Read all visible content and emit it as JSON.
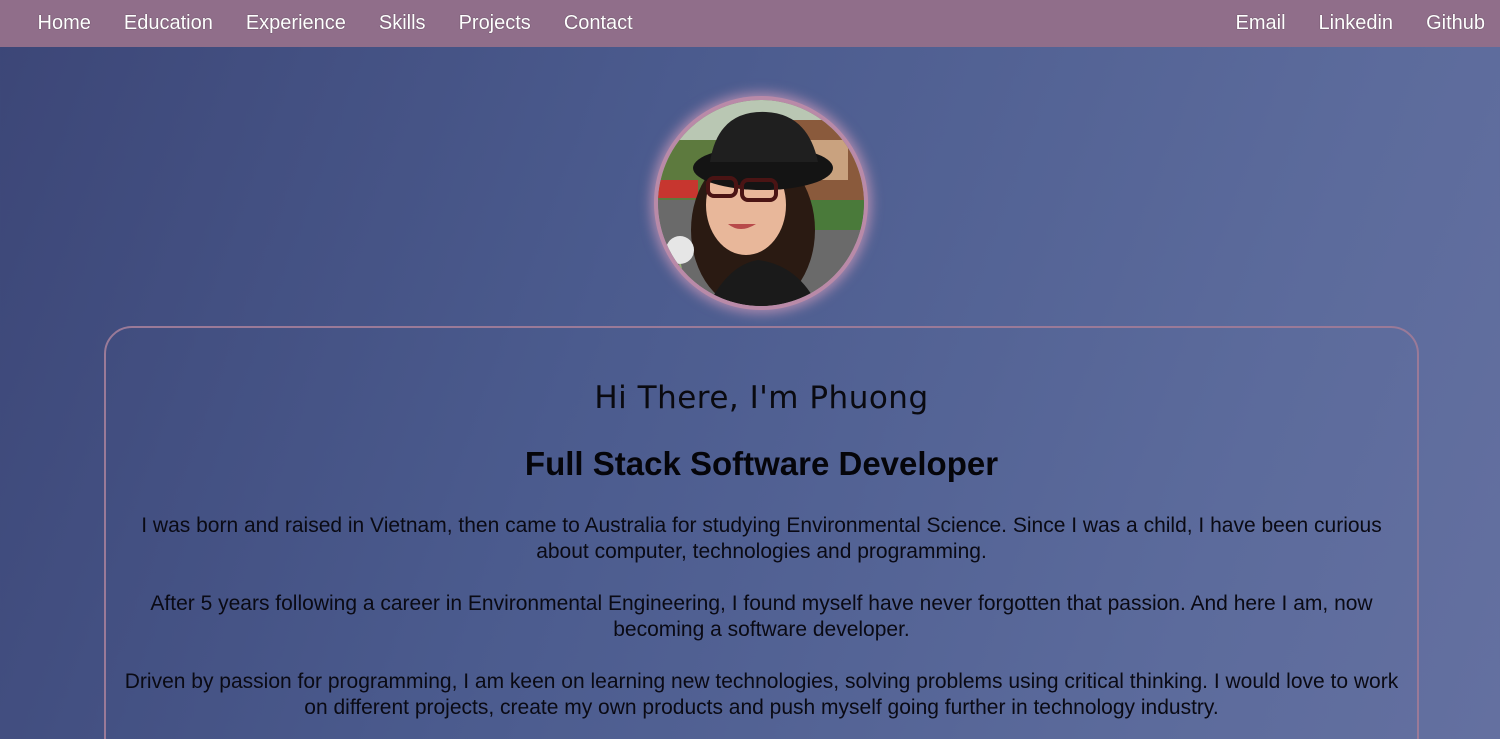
{
  "nav": {
    "left": [
      "Home",
      "Education",
      "Experience",
      "Skills",
      "Projects",
      "Contact"
    ],
    "right": [
      "Email",
      "Linkedin",
      "Github"
    ]
  },
  "profile": {
    "photo_icon": "profile-photo"
  },
  "intro": {
    "greeting": "Hi There, I'm Phuong",
    "role": "Full Stack Software Developer",
    "paragraphs": [
      "I was born and raised in Vietnam, then came to Australia for studying Environmental Science. Since I was a child, I have been curious about computer, technologies and programming.",
      "After 5 years following a career in Environmental Engineering, I found myself have never forgotten that passion. And here I am, now becoming a software developer.",
      "Driven by passion for programming, I am keen on learning new technologies, solving problems using critical thinking. I would love to work on different projects, create my own products and push myself going further in technology industry."
    ]
  },
  "colors": {
    "nav_bg": "#906e8a",
    "page_gradient_start": "#3c4677",
    "page_gradient_end": "#6470a0",
    "card_border": "#9a7a98"
  }
}
